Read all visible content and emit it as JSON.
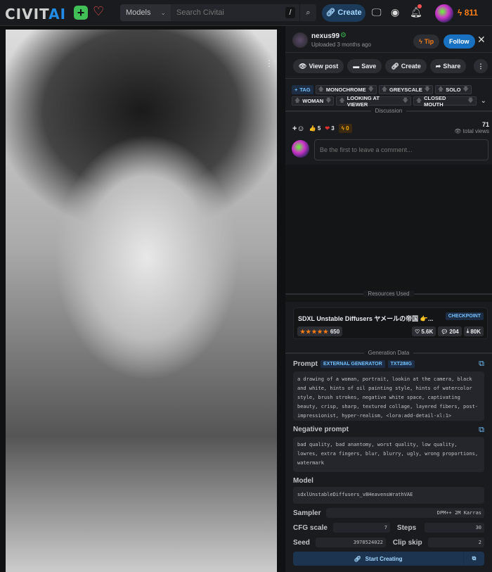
{
  "header": {
    "logo_a": "CIV",
    "logo_i": "IT",
    "logo_b": "AI",
    "search_scope": "Models",
    "search_placeholder": "Search Civitai",
    "shortcut": "/",
    "create_label": "Create",
    "buzz": "811"
  },
  "post": {
    "username": "nexus99",
    "uploaded": "Uploaded 3 months ago",
    "tip_label": "Tip",
    "follow_label": "Follow",
    "actions": [
      "View post",
      "Save",
      "Create",
      "Share"
    ],
    "add_tag": "TAG",
    "tags": [
      "MONOCHROME",
      "GREYSCALE",
      "SOLO",
      "WOMAN",
      "LOOKING AT VIEWER",
      "CLOSED MOUTH"
    ],
    "discussion_label": "Discussion",
    "likes": "5",
    "hearts": "3",
    "buzz_reactions": "0",
    "views": "71",
    "views_label": "total views",
    "comment_placeholder": "Be the first to leave a comment..."
  },
  "resources": {
    "label": "Resources Used",
    "name": "SDXL Unstable Diffusers ヤメールの帝国 👉...",
    "type": "CHECKPOINT",
    "rating_count": "650",
    "stars": 5,
    "likes": "5.6K",
    "comments": "204",
    "downloads": "80K"
  },
  "generation": {
    "label": "Generation Data",
    "prompt_label": "Prompt",
    "badges": [
      "EXTERNAL GENERATOR",
      "TXT2IMG"
    ],
    "prompt": "a drawing of a woman, portrait, lookin at the camera, black and white, hints of oil painting style, hints of watercolor style, brush strokes, negative white space, captivating beauty, crisp, sharp, textured collage, layered fibers, post-impressionist, hyper-realism, <lora:add-detail-xl:1>",
    "negative_label": "Negative prompt",
    "negative": "bad quality, bad anantomy, worst quality, low quality, lowres, extra fingers, blur, blurry, ugly, wrong proportions, watermark",
    "model_label": "Model",
    "model": "sdxlUnstableDiffusers_v8HeavensWrathVAE",
    "sampler_label": "Sampler",
    "sampler": "DPM++ 2M Karras",
    "cfg_label": "CFG scale",
    "cfg": "7",
    "steps_label": "Steps",
    "steps": "30",
    "seed_label": "Seed",
    "seed": "3978524022",
    "clip_label": "Clip skip",
    "clip": "2",
    "start_label": "Start Creating"
  }
}
